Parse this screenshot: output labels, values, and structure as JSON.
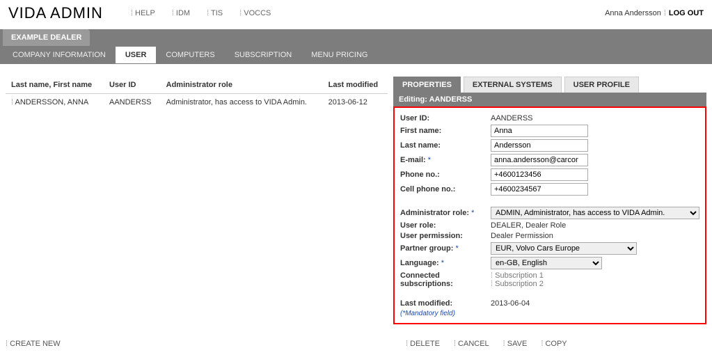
{
  "brand": "VIDA ADMIN",
  "topnav": {
    "help": "HELP",
    "idm": "IDM",
    "tis": "TIS",
    "voccs": "VOCCS"
  },
  "user": {
    "name": "Anna Andersson",
    "logout": "LOG OUT"
  },
  "dealer": "EXAMPLE DEALER",
  "tabs": {
    "company": "COMPANY INFORMATION",
    "user": "USER",
    "computers": "COMPUTERS",
    "subscription": "SUBSCRIPTION",
    "menu_pricing": "MENU PRICING"
  },
  "list": {
    "headers": {
      "name": "Last name, First name",
      "userid": "User ID",
      "role": "Administrator role",
      "modified": "Last modified"
    },
    "rows": [
      {
        "name": "ANDERSSON, ANNA",
        "userid": "AANDERSS",
        "role": "Administrator, has access to VIDA Admin.",
        "modified": "2013-06-12"
      }
    ]
  },
  "subtabs": {
    "properties": "PROPERTIES",
    "external": "EXTERNAL SYSTEMS",
    "profile": "USER PROFILE"
  },
  "panel": {
    "editing": "Editing: AANDERSS",
    "labels": {
      "userid": "User ID:",
      "first": "First name:",
      "last": "Last name:",
      "email": "E-mail:",
      "phone": "Phone no.:",
      "cell": "Cell phone no.:",
      "adminrole": "Administrator role:",
      "userrole": "User role:",
      "permission": "User permission:",
      "partner": "Partner group:",
      "language": "Language:",
      "connected": "Connected subscriptions:",
      "modified": "Last modified:"
    },
    "values": {
      "userid": "AANDERSS",
      "first": "Anna",
      "last": "Andersson",
      "email": "anna.andersson@carcor",
      "phone": "+4600123456",
      "cell": "+4600234567",
      "adminrole": "ADMIN, Administrator, has access to VIDA Admin.",
      "userrole": "DEALER, Dealer Role",
      "permission": "Dealer Permission",
      "partner": "EUR, Volvo Cars Europe",
      "language": "en-GB, English",
      "sub1": "Subscription 1",
      "sub2": "Subscription 2",
      "modified": "2013-06-04"
    },
    "mandatory": "(*Mandatory field)",
    "ast": "*"
  },
  "footer": {
    "create": "CREATE NEW",
    "delete": "DELETE",
    "cancel": "CANCEL",
    "save": "SAVE",
    "copy": "COPY"
  }
}
